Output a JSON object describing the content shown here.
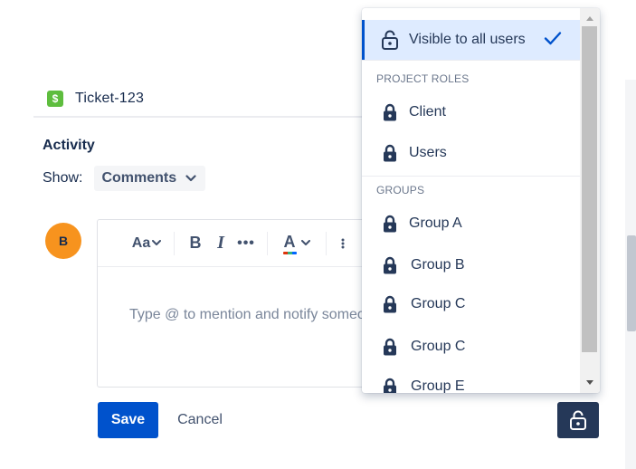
{
  "ticket": {
    "icon_glyph": "$",
    "key": "Ticket-123"
  },
  "activity": {
    "title": "Activity",
    "show_label": "Show:",
    "show_value": "Comments"
  },
  "avatar": {
    "initial": "B",
    "color": "#f7931e"
  },
  "editor": {
    "toolbar": {
      "text_style": "Aa",
      "bold": "B",
      "italic": "I",
      "more": "•••",
      "text_color": "A"
    },
    "placeholder": "Type @ to mention and notify someone."
  },
  "actions": {
    "save_label": "Save",
    "cancel_label": "Cancel"
  },
  "dropdown": {
    "selected": {
      "label": "Visible to all users",
      "icon": "unlock-icon"
    },
    "sections": [
      {
        "heading": "PROJECT ROLES",
        "items": [
          {
            "label": "Client",
            "icon": "lock-icon"
          },
          {
            "label": "Users",
            "icon": "lock-icon"
          }
        ]
      },
      {
        "heading": "GROUPS",
        "items": [
          {
            "label": "Group A",
            "icon": "lock-icon"
          },
          {
            "label": "Group B",
            "icon": "lock-icon"
          },
          {
            "label": "Group C",
            "icon": "lock-icon"
          },
          {
            "label": "Group C",
            "icon": "lock-icon"
          },
          {
            "label": "Group E",
            "icon": "lock-icon"
          }
        ]
      }
    ]
  },
  "colors": {
    "primary": "#0052cc",
    "selected_bg": "#deebff",
    "text": "#172b4d",
    "visibility_button": "#253858"
  }
}
